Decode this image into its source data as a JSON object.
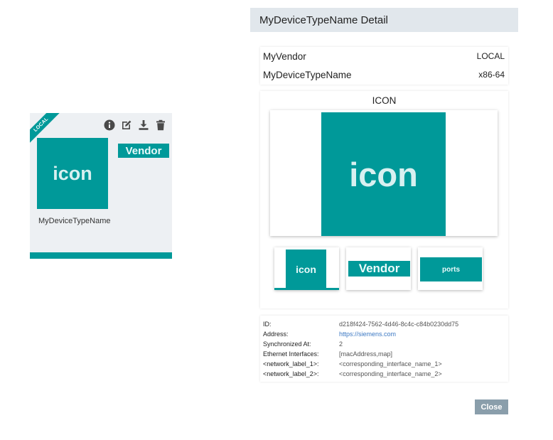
{
  "card": {
    "ribbon": "LOCAL",
    "icon_text": "icon",
    "vendor_text": "Vendor",
    "name": "MyDeviceTypeName",
    "actions": [
      "info-icon",
      "edit-icon",
      "download-icon",
      "delete-icon"
    ]
  },
  "panel": {
    "title": "MyDeviceTypeName Detail",
    "summary": {
      "vendor": "MyVendor",
      "source": "LOCAL",
      "name": "MyDeviceTypeName",
      "arch": "x86-64"
    },
    "icon_section": {
      "title": "ICON",
      "preview_text": "icon",
      "thumbs": [
        {
          "text": "icon",
          "selected": true
        },
        {
          "text": "Vendor",
          "selected": false
        },
        {
          "text": "ports",
          "selected": false
        }
      ]
    },
    "details": [
      {
        "label": "ID:",
        "value": "d218f424-7562-4d46-8c4c-c84b0230dd75"
      },
      {
        "label": "Address:",
        "value": "https://siemens.com"
      },
      {
        "label": "Synchronized At:",
        "value": "2"
      },
      {
        "label": "Ethernet Interfaces:",
        "value": "[macAddress,map]"
      },
      {
        "label": "<network_label_1>:",
        "value": "<corresponding_interface_name_1>"
      },
      {
        "label": "<network_label_2>:",
        "value": "<corresponding_interface_name_2>"
      }
    ],
    "close_label": "Close"
  },
  "colors": {
    "accent": "#009999",
    "header_bg": "#e1e7ec",
    "card_bg": "#edf0f3",
    "link": "#3b78c3",
    "button": "#8a9eab"
  }
}
